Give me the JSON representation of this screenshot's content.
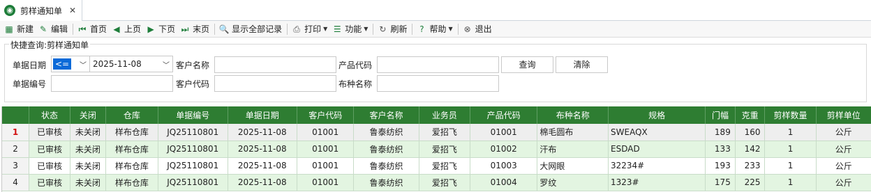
{
  "tab": {
    "title": "剪样通知单",
    "close": "✕"
  },
  "toolbar": [
    {
      "id": "new",
      "label": "新建",
      "icon": "new-icon",
      "glyph": "▦"
    },
    {
      "id": "edit",
      "label": "编辑",
      "icon": "edit-icon",
      "glyph": "✎"
    },
    {
      "id": "first",
      "label": "首页",
      "icon": "first-page-icon",
      "glyph": "⏮"
    },
    {
      "id": "prev",
      "label": "上页",
      "icon": "prev-page-icon",
      "glyph": "◀"
    },
    {
      "id": "next",
      "label": "下页",
      "icon": "next-page-icon",
      "glyph": "▶"
    },
    {
      "id": "last",
      "label": "末页",
      "icon": "last-page-icon",
      "glyph": "⏭"
    },
    {
      "id": "showall",
      "label": "显示全部记录",
      "icon": "search-doc-icon",
      "glyph": "🔍"
    },
    {
      "id": "print",
      "label": "打印",
      "icon": "print-icon",
      "glyph": "⎙"
    },
    {
      "id": "func",
      "label": "功能",
      "icon": "list-icon",
      "glyph": "☰"
    },
    {
      "id": "refresh",
      "label": "刷新",
      "icon": "refresh-icon",
      "glyph": "↻"
    },
    {
      "id": "help",
      "label": "帮助",
      "icon": "help-icon",
      "glyph": "?"
    },
    {
      "id": "exit",
      "label": "退出",
      "icon": "exit-icon",
      "glyph": "⊗"
    }
  ],
  "filter": {
    "title": "快捷查询:剪样通知单",
    "date_label": "单据日期",
    "date_op": "<=",
    "date_value": "2025-11-08",
    "doc_no_label": "单据编号",
    "doc_no_value": "",
    "cust_name_label": "客户名称",
    "cust_name_value": "",
    "cust_code_label": "客户代码",
    "cust_code_value": "",
    "prod_code_label": "产品代码",
    "prod_code_value": "",
    "fabric_label": "布种名称",
    "fabric_value": "",
    "query_btn": "查询",
    "clear_btn": "清除"
  },
  "grid": {
    "columns": [
      "状态",
      "关闭",
      "仓库",
      "单据编号",
      "单据日期",
      "客户代码",
      "客户名称",
      "业务员",
      "产品代码",
      "布种名称",
      "规格",
      "门幅",
      "克重",
      "剪样数量",
      "剪样单位"
    ],
    "rows": [
      {
        "num": "1",
        "cells": [
          "已审核",
          "未关闭",
          "样布仓库",
          "JQ25110801",
          "2025-11-08",
          "01001",
          "鲁泰纺织",
          "爱招飞",
          "01001",
          "棉毛圆布",
          "SWEAQX",
          "189",
          "160",
          "1",
          "公斤"
        ]
      },
      {
        "num": "2",
        "cells": [
          "已审核",
          "未关闭",
          "样布仓库",
          "JQ25110801",
          "2025-11-08",
          "01001",
          "鲁泰纺织",
          "爱招飞",
          "01002",
          "汗布",
          "ESDAD",
          "133",
          "142",
          "1",
          "公斤"
        ]
      },
      {
        "num": "3",
        "cells": [
          "已审核",
          "未关闭",
          "样布仓库",
          "JQ25110801",
          "2025-11-08",
          "01001",
          "鲁泰纺织",
          "爱招飞",
          "01003",
          "大网眼",
          "32234#",
          "193",
          "233",
          "1",
          "公斤"
        ]
      },
      {
        "num": "4",
        "cells": [
          "已审核",
          "未关闭",
          "样布仓库",
          "JQ25110801",
          "2025-11-08",
          "01001",
          "鲁泰纺织",
          "爱招飞",
          "01004",
          "罗纹",
          "1323#",
          "175",
          "225",
          "1",
          "公斤"
        ]
      }
    ]
  }
}
